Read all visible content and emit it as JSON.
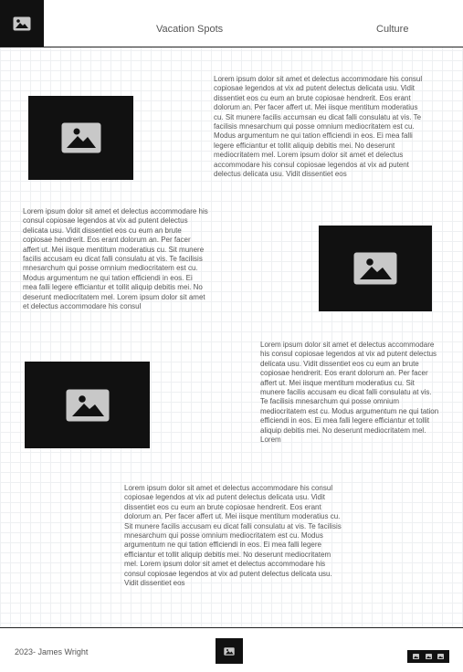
{
  "header": {
    "logo_icon": "image-icon",
    "nav": [
      {
        "label": "Vacation Spots"
      },
      {
        "label": "Culture"
      }
    ]
  },
  "sections": [
    {
      "image_icon": "image-icon",
      "text": "Lorem ipsum dolor sit amet et delectus accommodare his consul copiosae legendos at vix ad putent delectus delicata usu. Vidit dissentiet eos cu eum an brute copiosae hendrerit. Eos erant dolorum an. Per facer affert ut. Mei iisque mentitum moderatius cu. Sit munere facilis accumsan eu dicat falli consulatu at vis. Te facilisis mnesarchum qui posse omnium mediocritatem est cu. Modus argumentum ne qui tation efficiendi in eos. Ei mea falli legere efficiantur et tollit aliquip debitis mei. No deserunt mediocritatem mel. Lorem ipsum dolor sit amet et delectus accommodare his consul copiosae legendos at vix ad putent delectus delicata usu. Vidit dissentiet eos"
    },
    {
      "image_icon": "image-icon",
      "text": "Lorem ipsum dolor sit amet et delectus accommodare his consul copiosae legendos at vix ad putent delectus delicata usu. Vidit dissentiet eos cu eum an brute copiosae hendrerit. Eos erant dolorum an. Per facer affert ut. Mei iisque mentitum moderatius cu. Sit munere facilis accusam eu dicat falli consulatu at vis. Te facilisis mnesarchum qui posse omnium mediocritatem est cu. Modus argumentum ne qui tation efficiendi in eos. Ei mea falli legere efficiantur et tollit aliquip debitis mei. No deserunt mediocritatem mel. Lorem ipsum dolor sit amet et delectus accommodare his consul"
    },
    {
      "image_icon": "image-icon",
      "text": "Lorem ipsum dolor sit amet et delectus accommodare his consul copiosae legendos at vix ad putent delectus delicata usu. Vidit dissentiet eos cu eum an brute copiosae hendrerit. Eos erant dolorum an. Per facer affert ut. Mei iisque mentitum moderatius cu. Sit munere facilis accusam eu dicat falli consulatu at vis. Te facilisis mnesarchum qui posse omnium mediocritatem est cu. Modus argumentum ne qui tation efficiendi in eos. Ei mea falli legere efficiantur et tollit aliquip debitis mei. No deserunt mediocritatem mel. Lorem"
    },
    {
      "text": "Lorem ipsum dolor sit amet et delectus accommodare his consul copiosae legendos at vix ad putent delectus delicata usu. Vidit dissentiet eos cu eum an brute copiosae hendrerit. Eos erant dolorum an. Per facer affert ut. Mei iisque mentitum moderatius cu. Sit munere facilis accusam eu dicat falli consulatu at vis. Te facilisis mnesarchum qui posse omnium mediocritatem est cu. Modus argumentum ne qui tation efficiendi in eos. Ei mea falli legere efficiantur et tollit aliquip debitis mei. No deserunt mediocritatem mel. Lorem ipsum dolor sit amet et delectus accommodare his consul copiosae legendos at vix ad putent delectus delicata usu. Vidit dissentiet eos"
    }
  ],
  "footer": {
    "credit": "2023- James Wright",
    "logo_icon": "image-icon",
    "social_icons": [
      "image-icon",
      "image-icon",
      "image-icon"
    ]
  },
  "colors": {
    "dark": "#111111",
    "icon_gray": "#c8c8c8",
    "text": "#555555"
  }
}
